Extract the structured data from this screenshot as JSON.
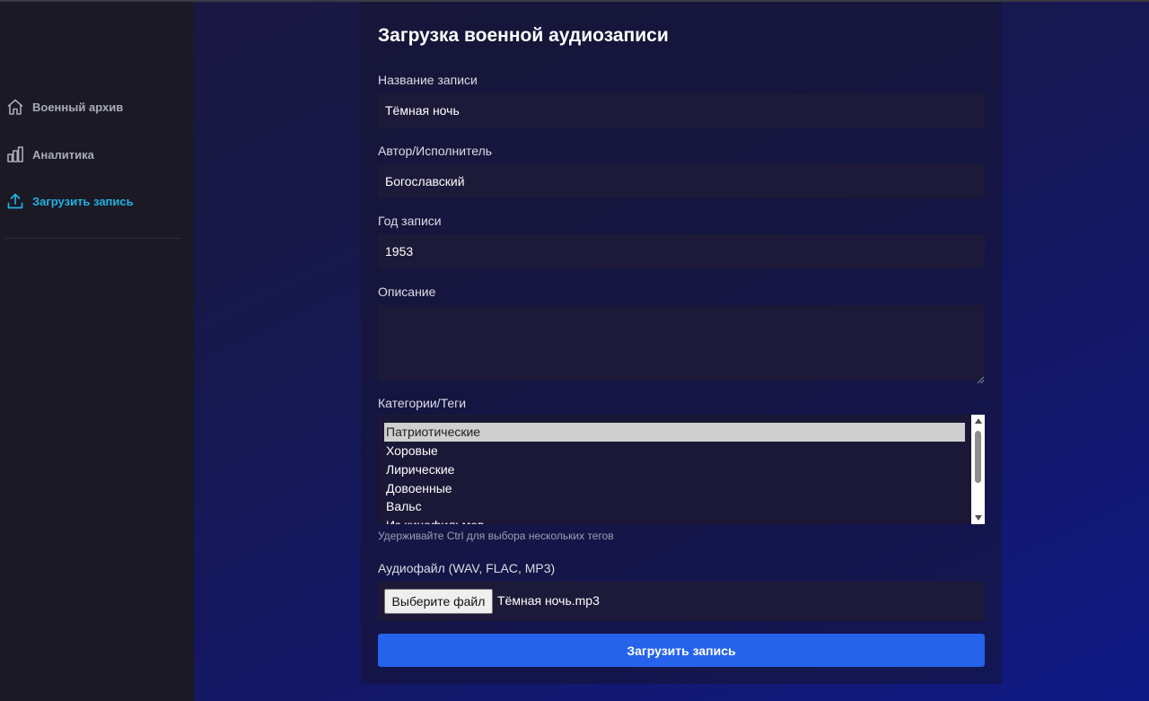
{
  "sidebar": {
    "items": [
      {
        "label": "Военный архив",
        "icon": "home-icon",
        "active": false
      },
      {
        "label": "Аналитика",
        "icon": "bar-chart-icon",
        "active": false
      },
      {
        "label": "Загрузить запись",
        "icon": "upload-icon",
        "active": true
      }
    ],
    "active_color": "#22b2e0"
  },
  "form": {
    "title": "Загрузка военной аудиозаписи",
    "name_label": "Название записи",
    "name_value": "Тёмная ночь",
    "author_label": "Автор/Исполнитель",
    "author_value": "Богославский",
    "year_label": "Год записи",
    "year_value": "1953",
    "description_label": "Описание",
    "description_value": "",
    "tags_label": "Категории/Теги",
    "tags": [
      {
        "label": "Патриотические",
        "selected": true
      },
      {
        "label": "Хоровые",
        "selected": false
      },
      {
        "label": "Лирические",
        "selected": false
      },
      {
        "label": "Довоенные",
        "selected": false
      },
      {
        "label": "Вальс",
        "selected": false
      },
      {
        "label": "Из кинофильмов",
        "selected": false
      }
    ],
    "tags_hint": "Удерживайте Ctrl для выбора нескольких тегов",
    "file_label": "Аудиофайл (WAV, FLAC, MP3)",
    "file_button_label": "Выберите файл",
    "file_name": "Тёмная ночь.mp3",
    "submit_label": "Загрузить запись",
    "submit_color": "#2563eb"
  }
}
